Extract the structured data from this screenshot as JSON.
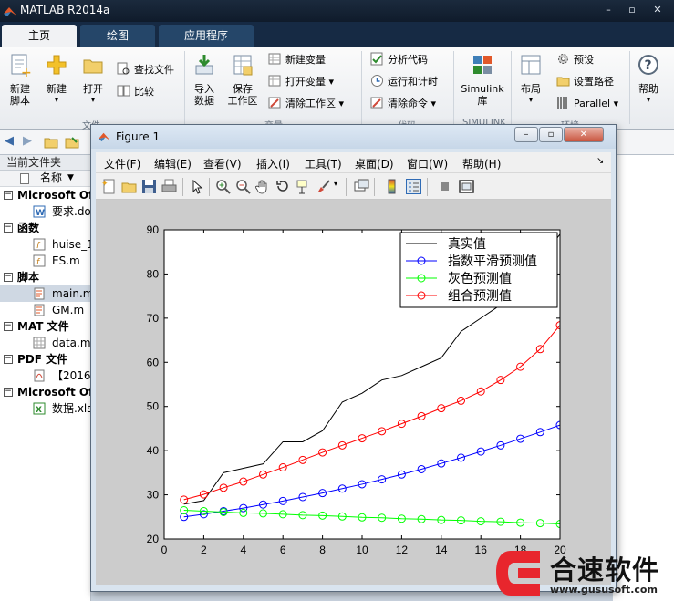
{
  "window": {
    "title": "MATLAB R2014a"
  },
  "main_tabs": [
    {
      "label": "主页",
      "active": true
    },
    {
      "label": "绘图",
      "active": false
    },
    {
      "label": "应用程序",
      "active": false
    }
  ],
  "ribbon": {
    "new_script": "新建\n脚本",
    "new": "新建",
    "open": "打开",
    "find_files": "查找文件",
    "compare": "比较",
    "import_data": "导入\n数据",
    "save_workspace": "保存\n工作区",
    "new_variable": "新建变量",
    "open_variable": "打开变量",
    "clear_workspace": "清除工作区",
    "analyze_code": "分析代码",
    "run_and_time": "运行和计时",
    "clear_commands": "清除命令",
    "simulink": "Simulink\n库",
    "layout": "布局",
    "preferences": "预设",
    "set_path": "设置路径",
    "parallel": "Parallel",
    "help": "帮助",
    "group_file": "文件",
    "group_variable": "变量",
    "group_code": "代码",
    "group_simulink": "SIMULINK",
    "group_env": "环境"
  },
  "file_browser": {
    "title": "当前文件夹",
    "column_name": "名称",
    "rows": [
      {
        "type": "group",
        "label": "Microsoft Of"
      },
      {
        "type": "file",
        "label": "要求.do",
        "icon": "word-doc-icon"
      },
      {
        "type": "group",
        "label": "函数"
      },
      {
        "type": "file",
        "label": "huise_1",
        "icon": "function-icon"
      },
      {
        "type": "file",
        "label": "ES.m",
        "icon": "function-icon"
      },
      {
        "type": "group",
        "label": "脚本"
      },
      {
        "type": "file",
        "label": "main.m",
        "icon": "script-icon",
        "selected": true
      },
      {
        "type": "file",
        "label": "GM.m",
        "icon": "script-icon"
      },
      {
        "type": "group",
        "label": "MAT 文件"
      },
      {
        "type": "file",
        "label": "data.m",
        "icon": "mat-file-icon"
      },
      {
        "type": "group",
        "label": "PDF 文件"
      },
      {
        "type": "file",
        "label": "【2016",
        "icon": "pdf-icon"
      },
      {
        "type": "group",
        "label": "Microsoft Of"
      },
      {
        "type": "file",
        "label": "数据.xls",
        "icon": "excel-icon"
      }
    ]
  },
  "figure": {
    "title": "Figure 1",
    "menus": [
      "文件(F)",
      "编辑(E)",
      "查看(V)",
      "插入(I)",
      "工具(T)",
      "桌面(D)",
      "窗口(W)",
      "帮助(H)"
    ],
    "chart_data": {
      "type": "line",
      "x": [
        1,
        2,
        3,
        4,
        5,
        6,
        7,
        8,
        9,
        10,
        11,
        12,
        13,
        14,
        15,
        16,
        17,
        18,
        19,
        20
      ],
      "xlim": [
        0,
        20
      ],
      "ylim": [
        20,
        90
      ],
      "xticks": [
        "0",
        "2",
        "4",
        "6",
        "8",
        "10",
        "12",
        "14",
        "16",
        "18",
        "20"
      ],
      "yticks": [
        "20",
        "30",
        "40",
        "50",
        "60",
        "70",
        "80",
        "90"
      ],
      "legend_position": "top-right",
      "series": [
        {
          "name": "真实值",
          "color": "#000000",
          "marker": "none",
          "values": [
            27.9,
            28.7,
            35.0,
            36.0,
            37.0,
            42.0,
            42.0,
            44.5,
            51.0,
            53.0,
            56.0,
            57.0,
            59.0,
            61.0,
            67.0,
            70.0,
            73.0,
            77.0,
            83.0,
            89.0
          ]
        },
        {
          "name": "指数平滑预测值",
          "color": "#0000ff",
          "marker": "circle",
          "values": [
            25.0,
            25.6,
            26.3,
            27.0,
            27.8,
            28.6,
            29.5,
            30.4,
            31.4,
            32.4,
            33.5,
            34.6,
            35.8,
            37.1,
            38.4,
            39.8,
            41.2,
            42.7,
            44.2,
            45.8
          ]
        },
        {
          "name": "灰色预测值",
          "color": "#00ff00",
          "marker": "circle",
          "values": [
            26.5,
            26.3,
            26.1,
            25.9,
            25.8,
            25.6,
            25.4,
            25.3,
            25.1,
            24.9,
            24.8,
            24.6,
            24.5,
            24.3,
            24.2,
            24.0,
            23.9,
            23.7,
            23.6,
            23.4
          ]
        },
        {
          "name": "组合预测值",
          "color": "#ff0000",
          "marker": "circle",
          "values": [
            28.9,
            30.1,
            31.6,
            33.0,
            34.6,
            36.2,
            37.9,
            39.6,
            41.2,
            42.8,
            44.4,
            46.1,
            47.8,
            49.6,
            51.3,
            53.4,
            56.0,
            59.0,
            63.0,
            68.4
          ]
        }
      ]
    }
  },
  "watermark": {
    "name": "合速软件",
    "url": "www.gususoft.com"
  }
}
